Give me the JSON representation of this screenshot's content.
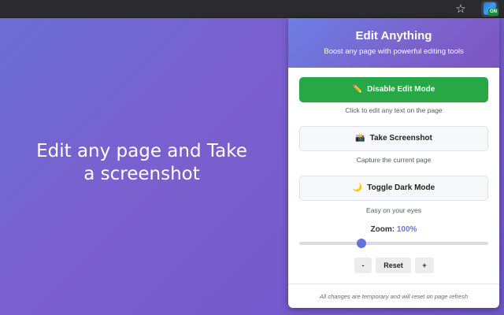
{
  "toolbar": {
    "star_icon": "star-icon",
    "extension_icon": "edit-anything-extension-icon",
    "extension_badge": "ON"
  },
  "hero": {
    "line1": "Edit any page and Take",
    "line2": "a screenshot"
  },
  "popup": {
    "title": "Edit Anything",
    "subtitle": "Boost any page with powerful editing tools",
    "buttons": [
      {
        "icon": "pencil-icon",
        "emoji": "✏️",
        "label": "Disable Edit Mode",
        "hint": "Click to edit any text on the page"
      },
      {
        "icon": "camera-icon",
        "emoji": "📸",
        "label": "Take Screenshot",
        "hint": "Capture the current page"
      },
      {
        "icon": "moon-icon",
        "emoji": "🌙",
        "label": "Toggle Dark Mode",
        "hint": "Easy on your eyes"
      }
    ],
    "zoom": {
      "label": "Zoom:",
      "value": "100%",
      "level": 0.33,
      "minus_label": "-",
      "reset_label": "Reset",
      "plus_label": "+"
    },
    "footer": "All changes are temporary and will reset on page refresh"
  },
  "colors": {
    "primary_button": "#28a745",
    "header_gradient_start": "#6b7fe3",
    "header_gradient_end": "#7c56c2",
    "accent": "#6a76dc"
  }
}
